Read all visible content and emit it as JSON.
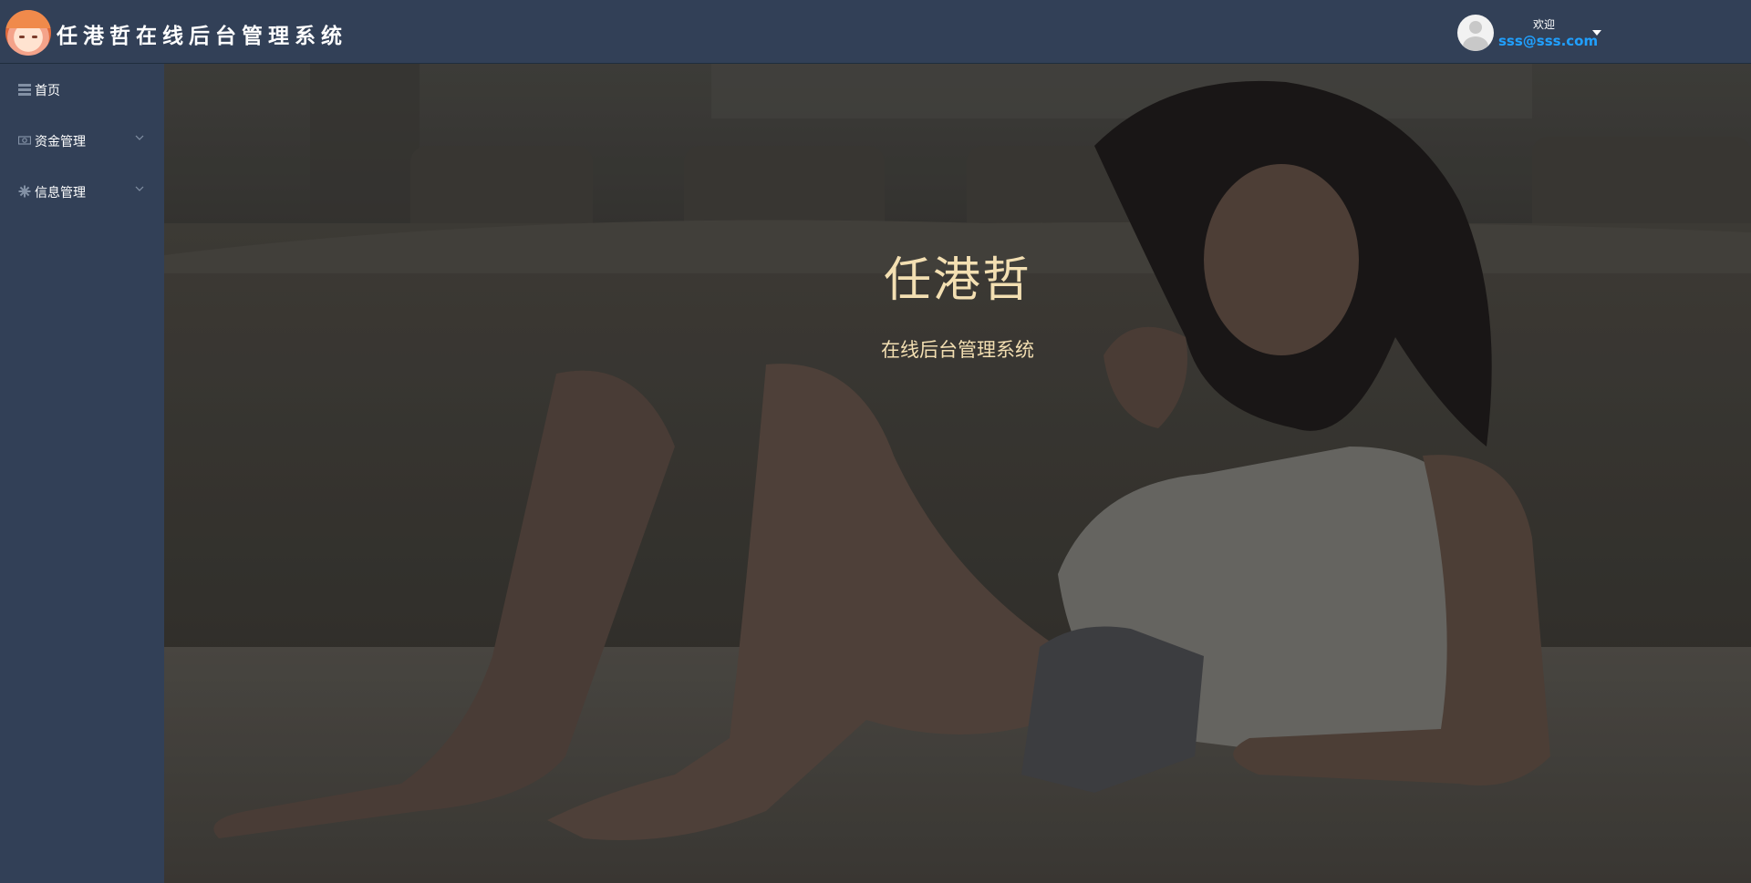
{
  "header": {
    "app_title": "任港哲在线后台管理系统",
    "logo_icon": "anime-girl-logo",
    "user": {
      "avatar_icon": "default-user-avatar",
      "welcome_text": "欢迎",
      "email": "sss@sss.com",
      "dropdown_icon": "caret-down-icon"
    }
  },
  "sidebar": {
    "items": [
      {
        "label": "首页",
        "icon": "list-icon",
        "has_submenu": false
      },
      {
        "label": "资金管理",
        "icon": "money-icon",
        "has_submenu": true
      },
      {
        "label": "信息管理",
        "icon": "gear-icon",
        "has_submenu": true
      }
    ]
  },
  "main": {
    "hero_title": "任港哲",
    "hero_subtitle": "在线后台管理系统",
    "background": "dimmed-photo-background"
  },
  "colors": {
    "header_bg": "#324057",
    "sidebar_bg": "#324057",
    "email_color": "#20a0ff",
    "hero_text": "#f3dfb2"
  }
}
